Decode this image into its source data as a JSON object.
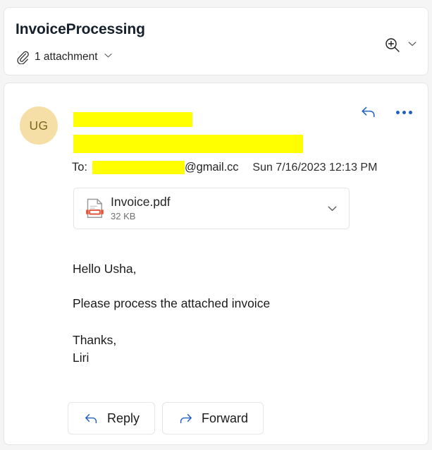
{
  "window": {
    "background_color": "#f5f5f5"
  },
  "subject_header": {
    "title": "InvoiceProcessing",
    "attachment_summary": "1 attachment",
    "attachment_icon": "paperclip-icon",
    "expand_icon": "chevron-down-icon",
    "zoom_icon": "zoom-in-icon",
    "zoom_chevron_icon": "chevron-down-icon"
  },
  "message": {
    "avatar_initials": "UG",
    "avatar_background": "#f5dfa6",
    "avatar_text_color": "#7a6a1c",
    "sender_name": "",
    "sender_email": "",
    "sender_redacted": true,
    "redaction_color": "#ffff00",
    "to_label": "To:",
    "to_recipient_redacted": true,
    "to_domain": "@gmail.cc",
    "timestamp": "Sun 7/16/2023 12:13 PM",
    "reply_icon": "reply-arrow-icon",
    "overflow_icon": "more-horizontal-icon",
    "accent_color": "#1f5fbf"
  },
  "attachment": {
    "file_name": "Invoice.pdf",
    "file_size": "32 KB",
    "file_icon": "pdf-file-icon",
    "expand_icon": "chevron-down-icon",
    "icon_accent_color": "#e2533b"
  },
  "body": {
    "greeting": "Hello Usha,",
    "paragraph": "Please process the attached invoice",
    "closing": "Thanks,",
    "signature": "Liri"
  },
  "actions": {
    "reply_label": "Reply",
    "reply_icon": "reply-arrow-icon",
    "forward_label": "Forward",
    "forward_icon": "forward-arrow-icon"
  }
}
